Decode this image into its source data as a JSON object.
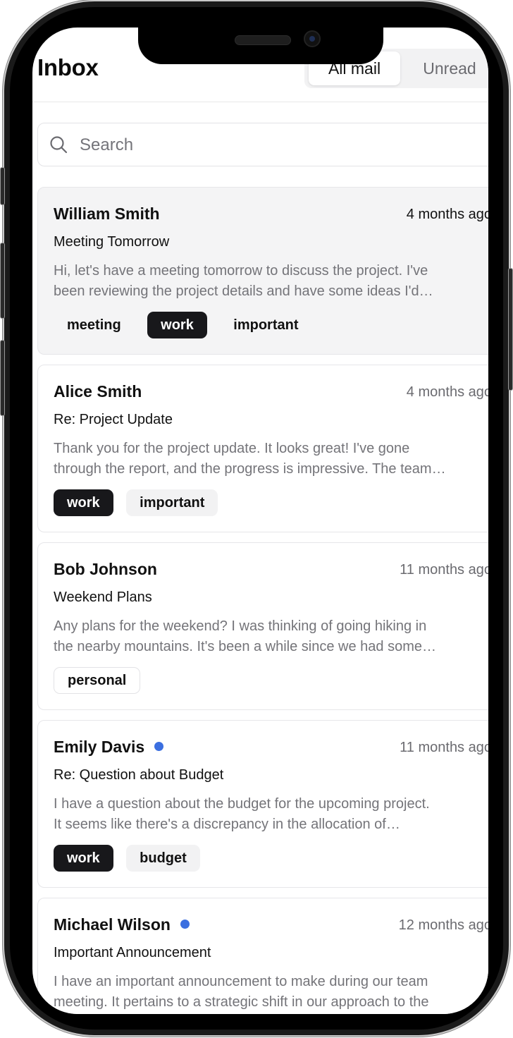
{
  "header": {
    "title": "Inbox"
  },
  "tabs": [
    {
      "label": "All mail",
      "active": true
    },
    {
      "label": "Unread",
      "active": false
    }
  ],
  "search": {
    "placeholder": "Search",
    "value": ""
  },
  "messages": [
    {
      "sender": "William Smith",
      "time": "4 months ago",
      "subject": "Meeting Tomorrow",
      "preview_line1": "Hi, let's have a meeting tomorrow to discuss the project. I've",
      "preview_line2": "been reviewing the project details and have some ideas I'd…",
      "unread": false,
      "selected": true,
      "tags": [
        {
          "label": "meeting",
          "style": "ghost"
        },
        {
          "label": "work",
          "style": "primary"
        },
        {
          "label": "important",
          "style": "ghost"
        }
      ]
    },
    {
      "sender": "Alice Smith",
      "time": "4 months ago",
      "subject": "Re: Project Update",
      "preview_line1": "Thank you for the project update. It looks great! I've gone",
      "preview_line2": "through the report, and the progress is impressive. The team…",
      "unread": false,
      "selected": false,
      "tags": [
        {
          "label": "work",
          "style": "primary"
        },
        {
          "label": "important",
          "style": "secondary"
        }
      ]
    },
    {
      "sender": "Bob Johnson",
      "time": "11 months ago",
      "subject": "Weekend Plans",
      "preview_line1": "Any plans for the weekend? I was thinking of going hiking in",
      "preview_line2": "the nearby mountains. It's been a while since we had some…",
      "unread": false,
      "selected": false,
      "tags": [
        {
          "label": "personal",
          "style": "outline"
        }
      ]
    },
    {
      "sender": "Emily Davis",
      "time": "11 months ago",
      "subject": "Re: Question about Budget",
      "preview_line1": "I have a question about the budget for the upcoming project.",
      "preview_line2": "It seems like there's a discrepancy in the allocation of…",
      "unread": true,
      "selected": false,
      "tags": [
        {
          "label": "work",
          "style": "primary"
        },
        {
          "label": "budget",
          "style": "secondary"
        }
      ]
    },
    {
      "sender": "Michael Wilson",
      "time": "12 months ago",
      "subject": "Important Announcement",
      "preview_line1": "I have an important announcement to make during our team",
      "preview_line2": "meeting. It pertains to a strategic shift in our approach to the",
      "unread": true,
      "selected": false,
      "tags": []
    }
  ],
  "colors": {
    "accent_dot": "#3b6fe0",
    "primary_tag": "#18181b"
  }
}
